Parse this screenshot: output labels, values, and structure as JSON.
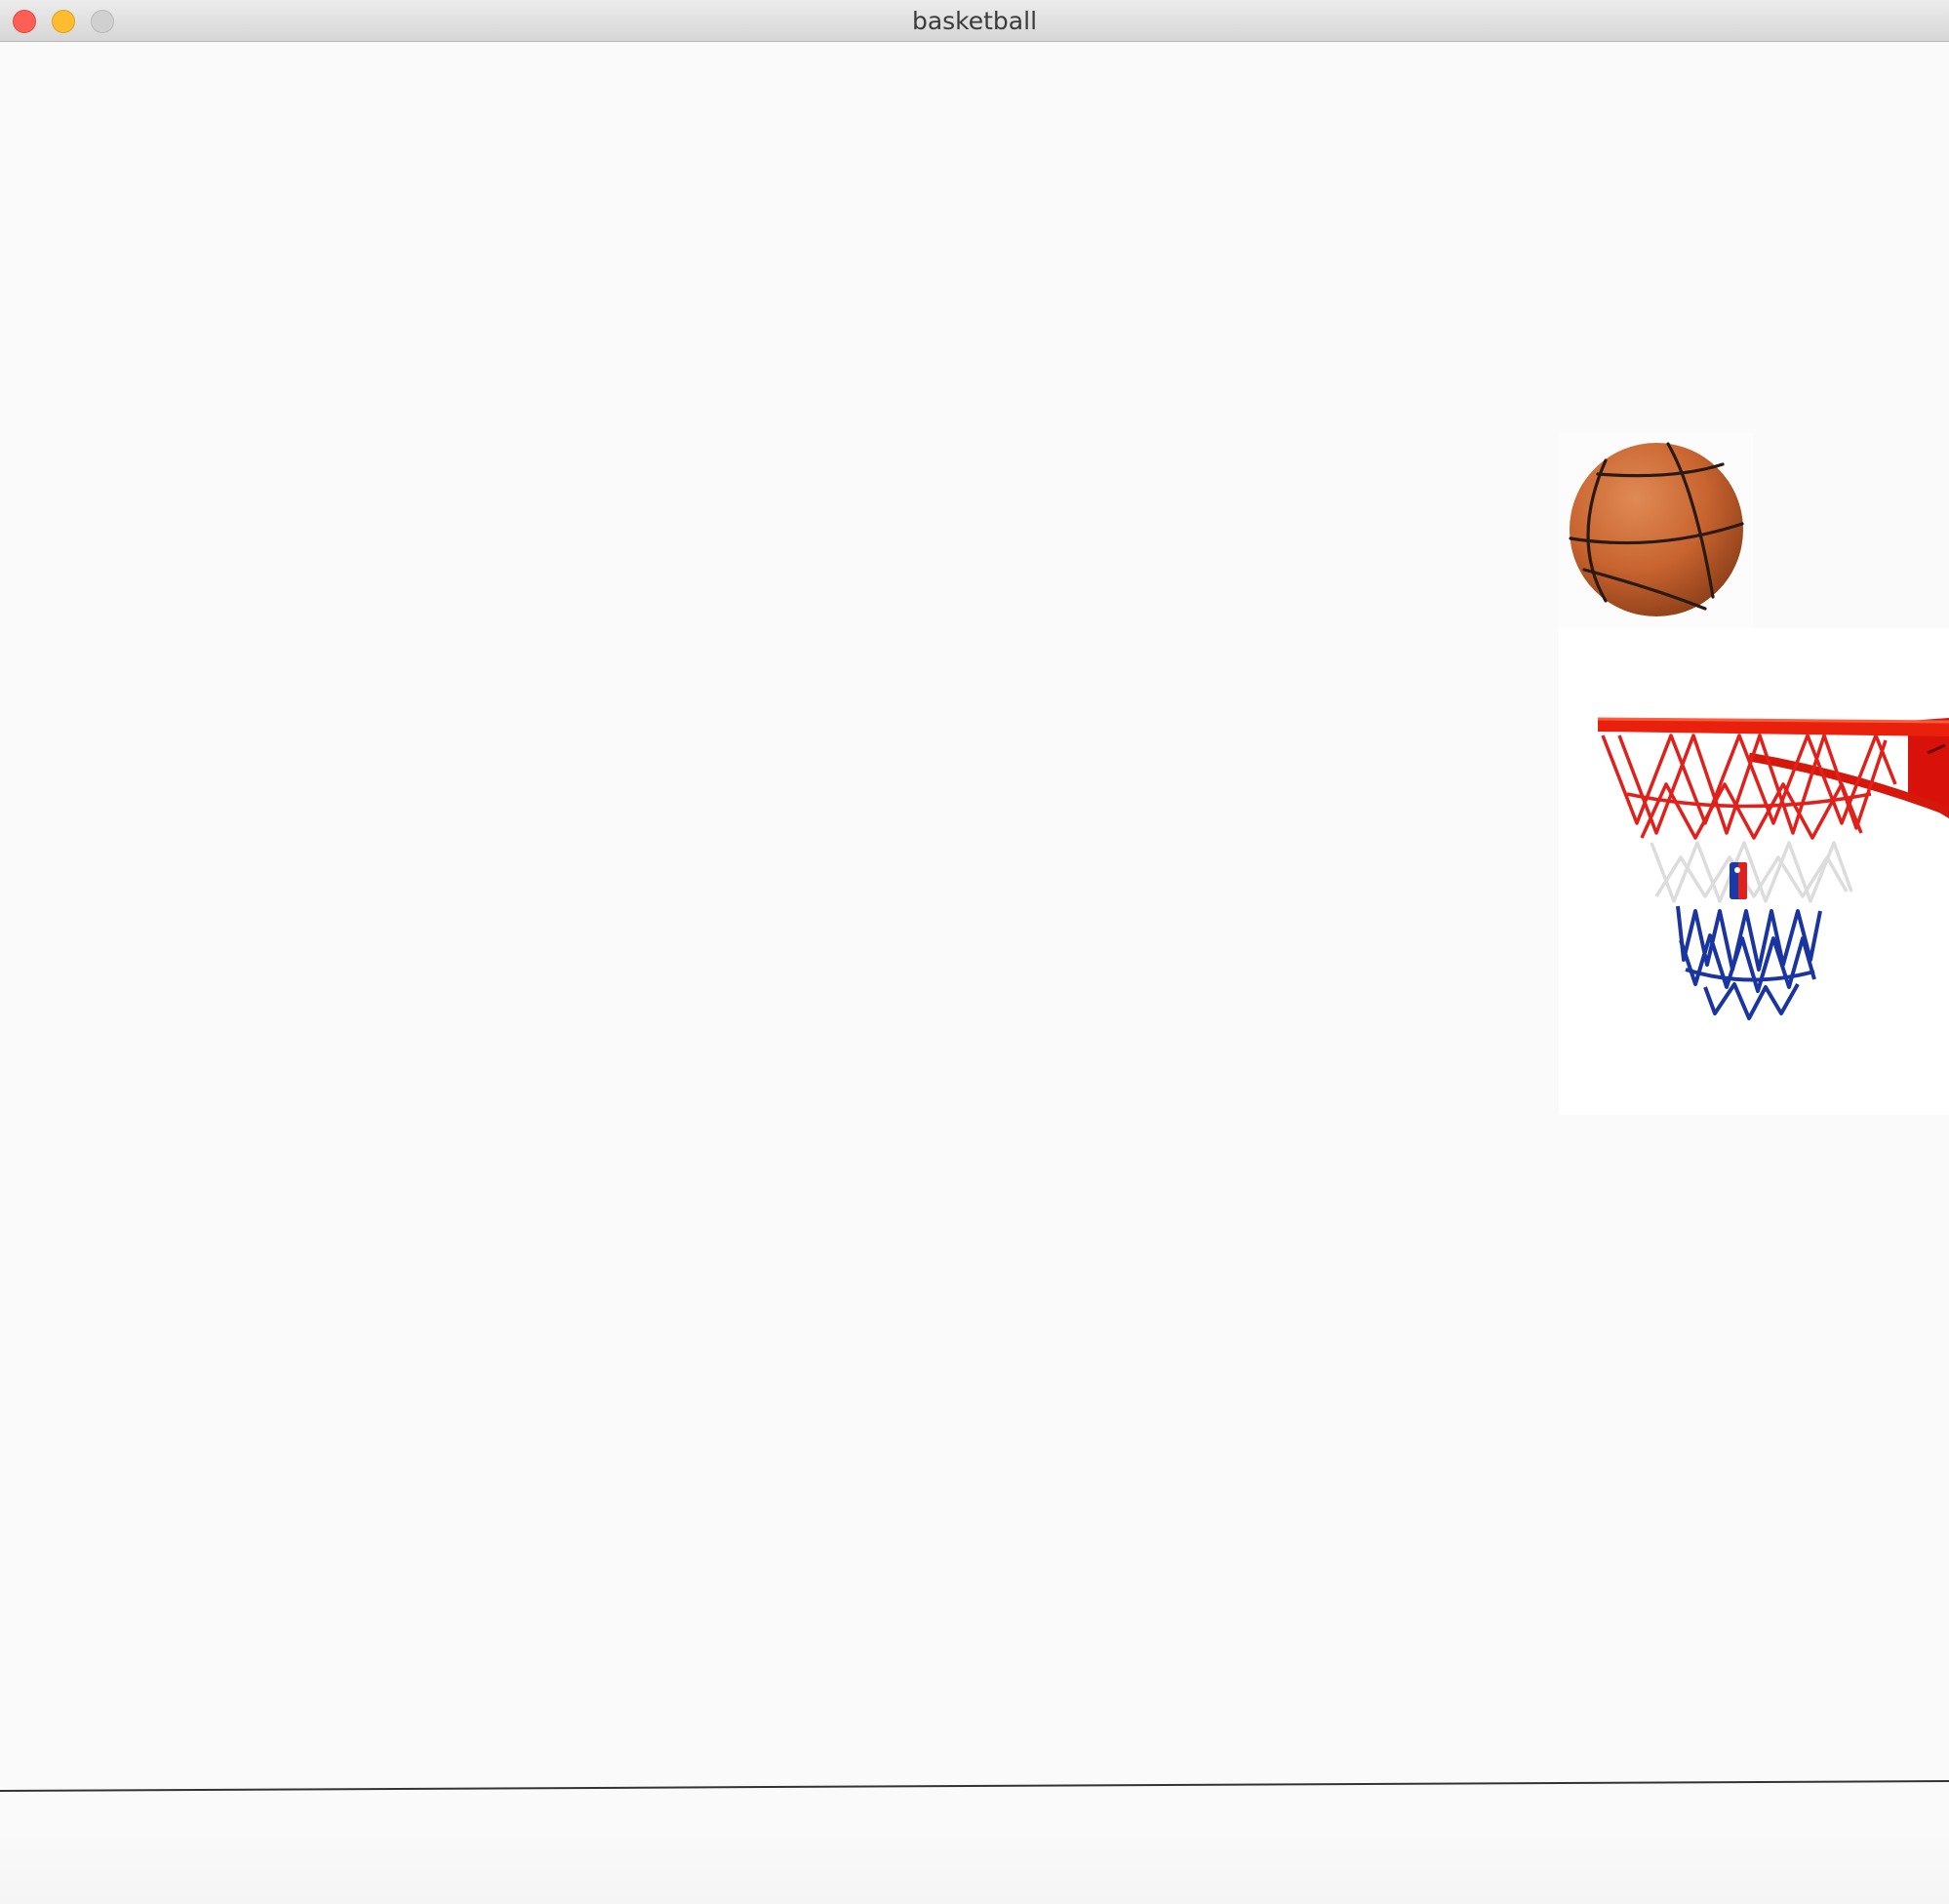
{
  "window": {
    "title": "basketball",
    "controls": {
      "close": "close-button",
      "minimize": "minimize-button",
      "zoom": "zoom-button"
    }
  },
  "scene": {
    "background_color": "#fafafa",
    "ground_line_color": "#333333",
    "sprites": [
      {
        "name": "basketball",
        "icon": "basketball-icon"
      },
      {
        "name": "hoop",
        "icon": "basketball-hoop-icon"
      }
    ],
    "colors": {
      "ball": "#c8642f",
      "rim": "#e8200c",
      "net_top": "#e0201a",
      "net_mid": "#f0f0f0",
      "net_bottom": "#1a35a0"
    }
  }
}
